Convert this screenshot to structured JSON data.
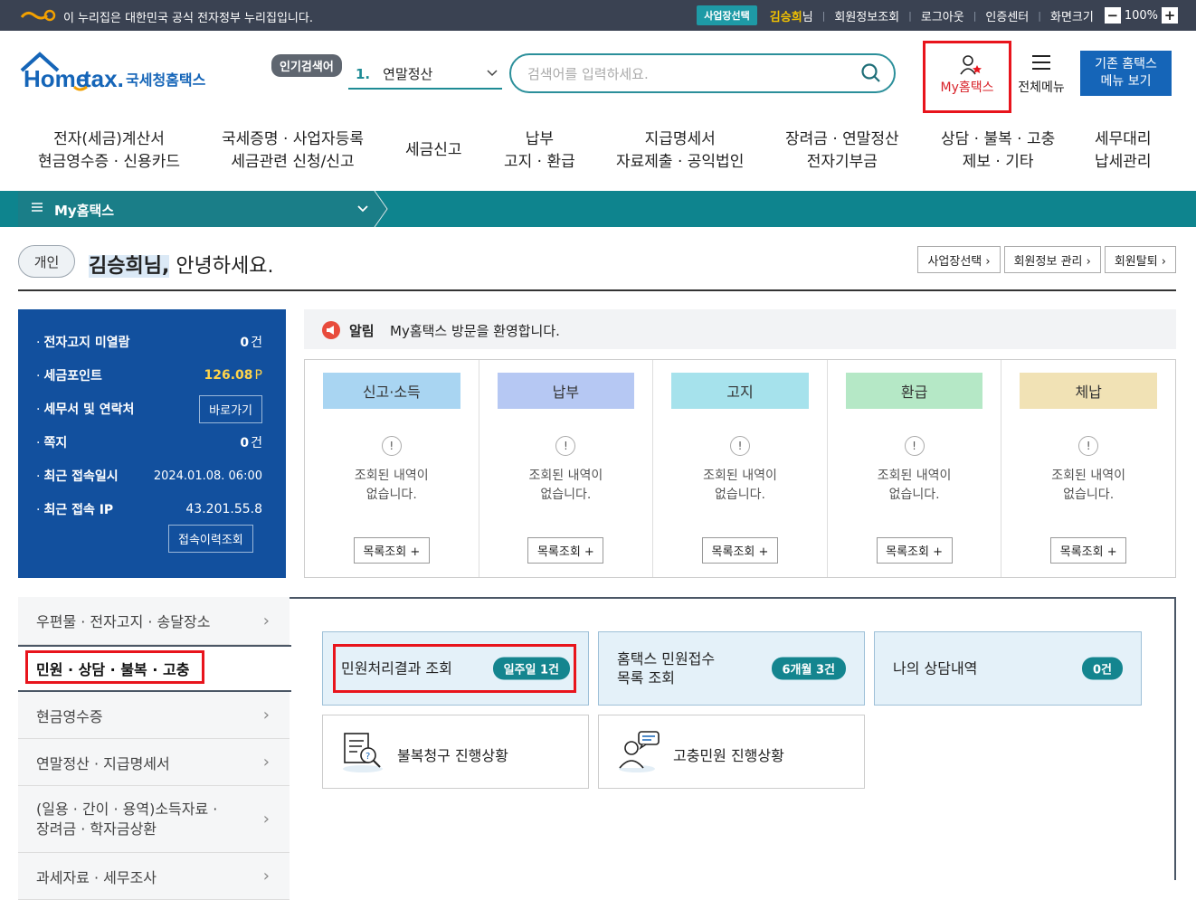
{
  "govbar": {
    "message": "이 누리집은 대한민국 공식 전자정부 누리집입니다.",
    "biz_select": "사업장선택",
    "user_name": "김승희",
    "user_suffix": "님",
    "links": [
      "회원정보조회",
      "로그아웃",
      "인증센터",
      "화면크기"
    ],
    "zoom": "100%"
  },
  "header": {
    "popular_label": "인기검색어",
    "popular_num": "1.",
    "popular_term": "연말정산",
    "search_placeholder": "검색어를 입력하세요.",
    "my_hometax": "My홈택스",
    "all_menu": "전체메뉴",
    "old_btn_l1": "기존 홈택스",
    "old_btn_l2": "메뉴 보기"
  },
  "gnb": [
    {
      "l1": "전자(세금)계산서",
      "l2": "현금영수증 · 신용카드"
    },
    {
      "l1": "국세증명 · 사업자등록",
      "l2": "세금관련 신청/신고"
    },
    {
      "l1": "세금신고",
      "l2": ""
    },
    {
      "l1": "납부",
      "l2": "고지 · 환급"
    },
    {
      "l1": "지급명세서",
      "l2": "자료제출 · 공익법인"
    },
    {
      "l1": "장려금 · 연말정산",
      "l2": "전자기부금"
    },
    {
      "l1": "상담 · 불복 · 고충",
      "l2": "제보 · 기타"
    },
    {
      "l1": "세무대리",
      "l2": "납세관리"
    }
  ],
  "subbar": {
    "title": "My홈택스"
  },
  "greeting": {
    "tag": "개인",
    "name": "김승희님,",
    "text": " 안녕하세요.",
    "buttons": [
      "사업장선택 ›",
      "회원정보 관리 ›",
      "회원탈퇴 ›"
    ]
  },
  "summary": [
    {
      "key": "전자고지 미열람",
      "value": "0",
      "unit": "건"
    },
    {
      "key": "세금포인트",
      "value": "126.08",
      "unit": "P"
    },
    {
      "key": "세무서 및 연락처",
      "button": "바로가기"
    },
    {
      "key": "쪽지",
      "value": "0",
      "unit": "건"
    },
    {
      "key": "최근 접속일시",
      "value": "2024.01.08.  06:00"
    },
    {
      "key": "최근 접속 IP",
      "value": "43.201.55.8"
    }
  ],
  "summary_button": "접속이력조회",
  "notice": {
    "label": "알림",
    "text": "My홈택스 방문을 환영합니다."
  },
  "status": [
    {
      "title": "신고·소득",
      "color": "#a9d5f2"
    },
    {
      "title": "납부",
      "color": "#b6c8f3"
    },
    {
      "title": "고지",
      "color": "#a6e2ec"
    },
    {
      "title": "환급",
      "color": "#b5e8c6"
    },
    {
      "title": "체납",
      "color": "#f1e2b5"
    }
  ],
  "status_empty_l1": "조회된 내역이",
  "status_empty_l2": "없습니다.",
  "status_button": "목록조회 +",
  "left_menu": [
    "우편물 · 전자고지 · 송달장소",
    "민원 · 상담 · 불복 · 고충",
    "현금영수증",
    "연말정산 · 지급명세서",
    "(일용 · 간이 · 용역)소득자료 ·",
    "장려금 · 학자금상환",
    "과세자료 · 세무조사"
  ],
  "cards": [
    {
      "title": "민원처리결과 조회",
      "pill": "일주일 1건"
    },
    {
      "title_l1": "홈택스 민원접수",
      "title_l2": "목록 조회",
      "pill": "6개월 3건"
    },
    {
      "title": "나의 상담내역",
      "pill": "0건"
    }
  ],
  "cards2": [
    "불복청구 진행상황",
    "고충민원 진행상황"
  ]
}
